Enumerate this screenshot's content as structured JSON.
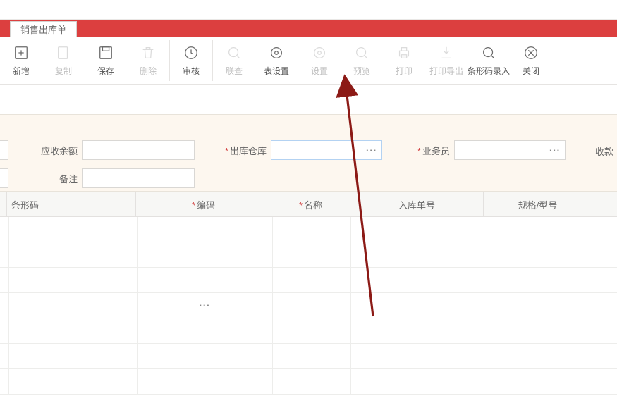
{
  "tab": {
    "label": "销售出库单"
  },
  "toolbar": {
    "new": "新增",
    "copy": "复制",
    "save": "保存",
    "delete": "删除",
    "audit": "审核",
    "linked": "联查",
    "tableset": "表设置",
    "setting": "设置",
    "preview": "预览",
    "print": "打印",
    "printexp": "打印导出",
    "barcode": "条形码录入",
    "close": "关闭"
  },
  "form": {
    "receivable_label": "应收余额",
    "warehouse_label": "出库仓库",
    "sales_label": "业务员",
    "remark_label": "备注",
    "collect_label": "收款"
  },
  "table": {
    "h_barcode": "条形码",
    "h_code": "编码",
    "h_name": "名称",
    "h_in_no": "入库单号",
    "h_spec": "规格/型号"
  }
}
